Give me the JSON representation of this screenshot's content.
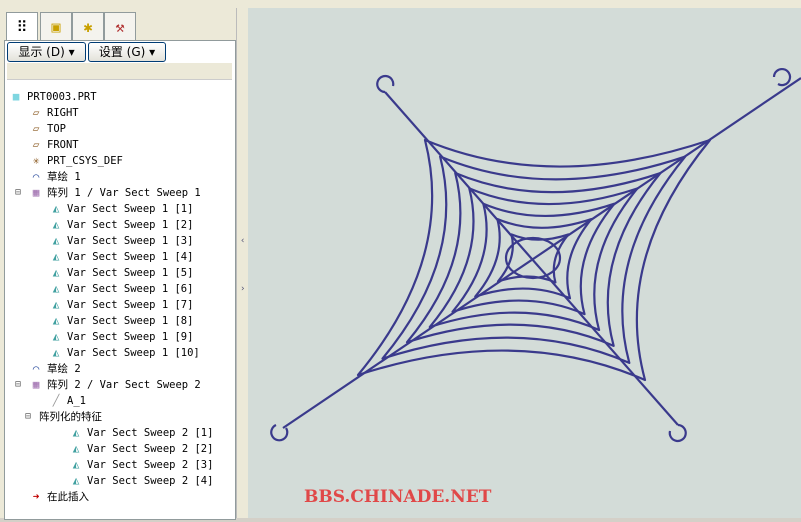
{
  "tabs": [
    {
      "icon": "model-tree-icon"
    },
    {
      "icon": "layers-icon"
    },
    {
      "icon": "folder-star-icon"
    },
    {
      "icon": "tools-folder-icon"
    }
  ],
  "buttons": {
    "show": "显示 (D) ▾",
    "settings": "设置 (G) ▾"
  },
  "tree": [
    {
      "label": "PRT0003.PRT",
      "icon": "part-icon",
      "indent": 0
    },
    {
      "label": "RIGHT",
      "icon": "datum-plane-icon",
      "indent": 1
    },
    {
      "label": "TOP",
      "icon": "datum-plane-icon",
      "indent": 1
    },
    {
      "label": "FRONT",
      "icon": "datum-plane-icon",
      "indent": 1
    },
    {
      "label": "PRT_CSYS_DEF",
      "icon": "csys-icon",
      "indent": 1
    },
    {
      "label": "草绘 1",
      "icon": "sketch-icon",
      "indent": 1
    },
    {
      "label": "阵列 1 / Var Sect Sweep 1",
      "icon": "pattern-icon",
      "indent": 1,
      "expander": "−"
    },
    {
      "label": "Var Sect Sweep 1 [1]",
      "icon": "sweep-icon",
      "indent": 2
    },
    {
      "label": "Var Sect Sweep 1 [2]",
      "icon": "sweep-icon",
      "indent": 2
    },
    {
      "label": "Var Sect Sweep 1 [3]",
      "icon": "sweep-icon",
      "indent": 2
    },
    {
      "label": "Var Sect Sweep 1 [4]",
      "icon": "sweep-icon",
      "indent": 2
    },
    {
      "label": "Var Sect Sweep 1 [5]",
      "icon": "sweep-icon",
      "indent": 2
    },
    {
      "label": "Var Sect Sweep 1 [6]",
      "icon": "sweep-icon",
      "indent": 2
    },
    {
      "label": "Var Sect Sweep 1 [7]",
      "icon": "sweep-icon",
      "indent": 2
    },
    {
      "label": "Var Sect Sweep 1 [8]",
      "icon": "sweep-icon",
      "indent": 2
    },
    {
      "label": "Var Sect Sweep 1 [9]",
      "icon": "sweep-icon",
      "indent": 2
    },
    {
      "label": "Var Sect Sweep 1 [10]",
      "icon": "sweep-icon",
      "indent": 2
    },
    {
      "label": "草绘 2",
      "icon": "sketch-icon",
      "indent": 1
    },
    {
      "label": "阵列 2 / Var Sect Sweep 2",
      "icon": "pattern-icon",
      "indent": 1,
      "expander": "−"
    },
    {
      "label": "A_1",
      "icon": "axis-icon",
      "indent": 2
    },
    {
      "label": "阵列化的特征",
      "icon": "",
      "indent": 1.5,
      "expander": "−"
    },
    {
      "label": "Var Sect Sweep 2 [1]",
      "icon": "sweep-icon",
      "indent": 3
    },
    {
      "label": "Var Sect Sweep 2 [2]",
      "icon": "sweep-icon",
      "indent": 3
    },
    {
      "label": "Var Sect Sweep 2 [3]",
      "icon": "sweep-icon",
      "indent": 3
    },
    {
      "label": "Var Sect Sweep 2 [4]",
      "icon": "sweep-icon",
      "indent": 3
    },
    {
      "label": "在此插入",
      "icon": "insert-arrow-icon",
      "indent": 1
    }
  ],
  "watermark": "BBS.CHINADE.NET",
  "colors": {
    "curve": "#3a3a8c",
    "canvas": "#d3dcd8",
    "watermark": "#e04848"
  }
}
